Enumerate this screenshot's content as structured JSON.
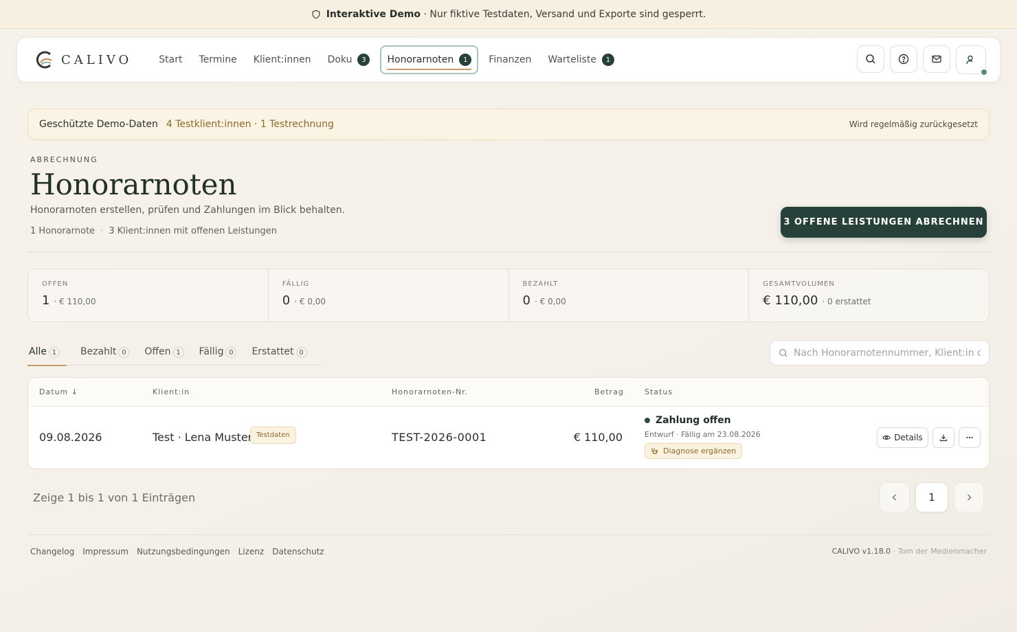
{
  "banner": {
    "title": "Interaktive Demo",
    "text": "· Nur fiktive Testdaten, Versand und Exporte sind gesperrt.",
    "icon": "shield-icon"
  },
  "nav": {
    "logo_text": "CALIVO",
    "items": [
      {
        "label": "Start"
      },
      {
        "label": "Termine"
      },
      {
        "label": "Klient:innen"
      },
      {
        "label": "Doku",
        "badge": "3"
      },
      {
        "label": "Honorarnoten",
        "badge": "1",
        "active": true
      },
      {
        "label": "Finanzen"
      },
      {
        "label": "Warteliste",
        "badge": "1"
      }
    ],
    "right_icons": [
      "search-icon",
      "help-icon",
      "mail-icon",
      "user-icon"
    ]
  },
  "info_bar": {
    "title": "Geschützte Demo-Daten",
    "text": "4 Testklient:innen · 1 Testrechnung",
    "right": "Wird regelmäßig zurückgesetzt"
  },
  "page": {
    "section_label": "ABRECHNUNG",
    "title": "Honorarnoten",
    "subtitle": "Honorarnoten erstellen, prüfen und Zahlungen im Blick behalten.",
    "stat_a": "1 Honorarnote",
    "stat_sep": "·",
    "stat_b": "3 Klient:innen mit offenen Leistungen",
    "primary_button": "3 OFFENE LEISTUNGEN ABRECHNEN"
  },
  "kpis": [
    {
      "label": "OFFEN",
      "value": "1",
      "sub": "· € 110,00"
    },
    {
      "label": "FÄLLIG",
      "value": "0",
      "sub": "· € 0,00"
    },
    {
      "label": "BEZAHLT",
      "value": "0",
      "sub": "· € 0,00"
    },
    {
      "label": "GESAMTVOLUMEN",
      "value": "€ 110,00",
      "sub": "· 0 erstattet"
    }
  ],
  "tabs": [
    {
      "label": "Alle",
      "count": "1",
      "active": true
    },
    {
      "label": "Bezahlt",
      "count": "0"
    },
    {
      "label": "Offen",
      "count": "1"
    },
    {
      "label": "Fällig",
      "count": "0"
    },
    {
      "label": "Erstattet",
      "count": "0"
    }
  ],
  "search": {
    "placeholder": "Nach Honorarnotennummer, Klient:in od"
  },
  "table": {
    "columns": {
      "date": "Datum ↓",
      "client": "Klient:in",
      "number": "Honorarnoten-Nr.",
      "amount": "Betrag",
      "status": "Status"
    },
    "rows": [
      {
        "date": "09.08.2026",
        "client": "Test · Lena Muster",
        "client_chip": "Testdaten",
        "number": "TEST-2026-0001",
        "amount": "€ 110,00",
        "status_title": "Zahlung offen",
        "status_sub": "Entwurf · Fällig am 23.08.2026",
        "status_chip": "Diagnose ergänzen",
        "details_label": "Details"
      }
    ]
  },
  "pagination": {
    "info": "Zeige 1 bis 1 von 1 Einträgen",
    "current_page": "1"
  },
  "footer": {
    "links": [
      "Changelog",
      "Impressum",
      "Nutzungsbedingungen",
      "Lizenz",
      "Datenschutz"
    ],
    "version": "CALIVO v1.18.0",
    "credit": "· Tom der Medienmacher"
  },
  "colors": {
    "primary": "#27413a",
    "accent": "#c89a6a",
    "warning_bg": "#fbf2df"
  }
}
